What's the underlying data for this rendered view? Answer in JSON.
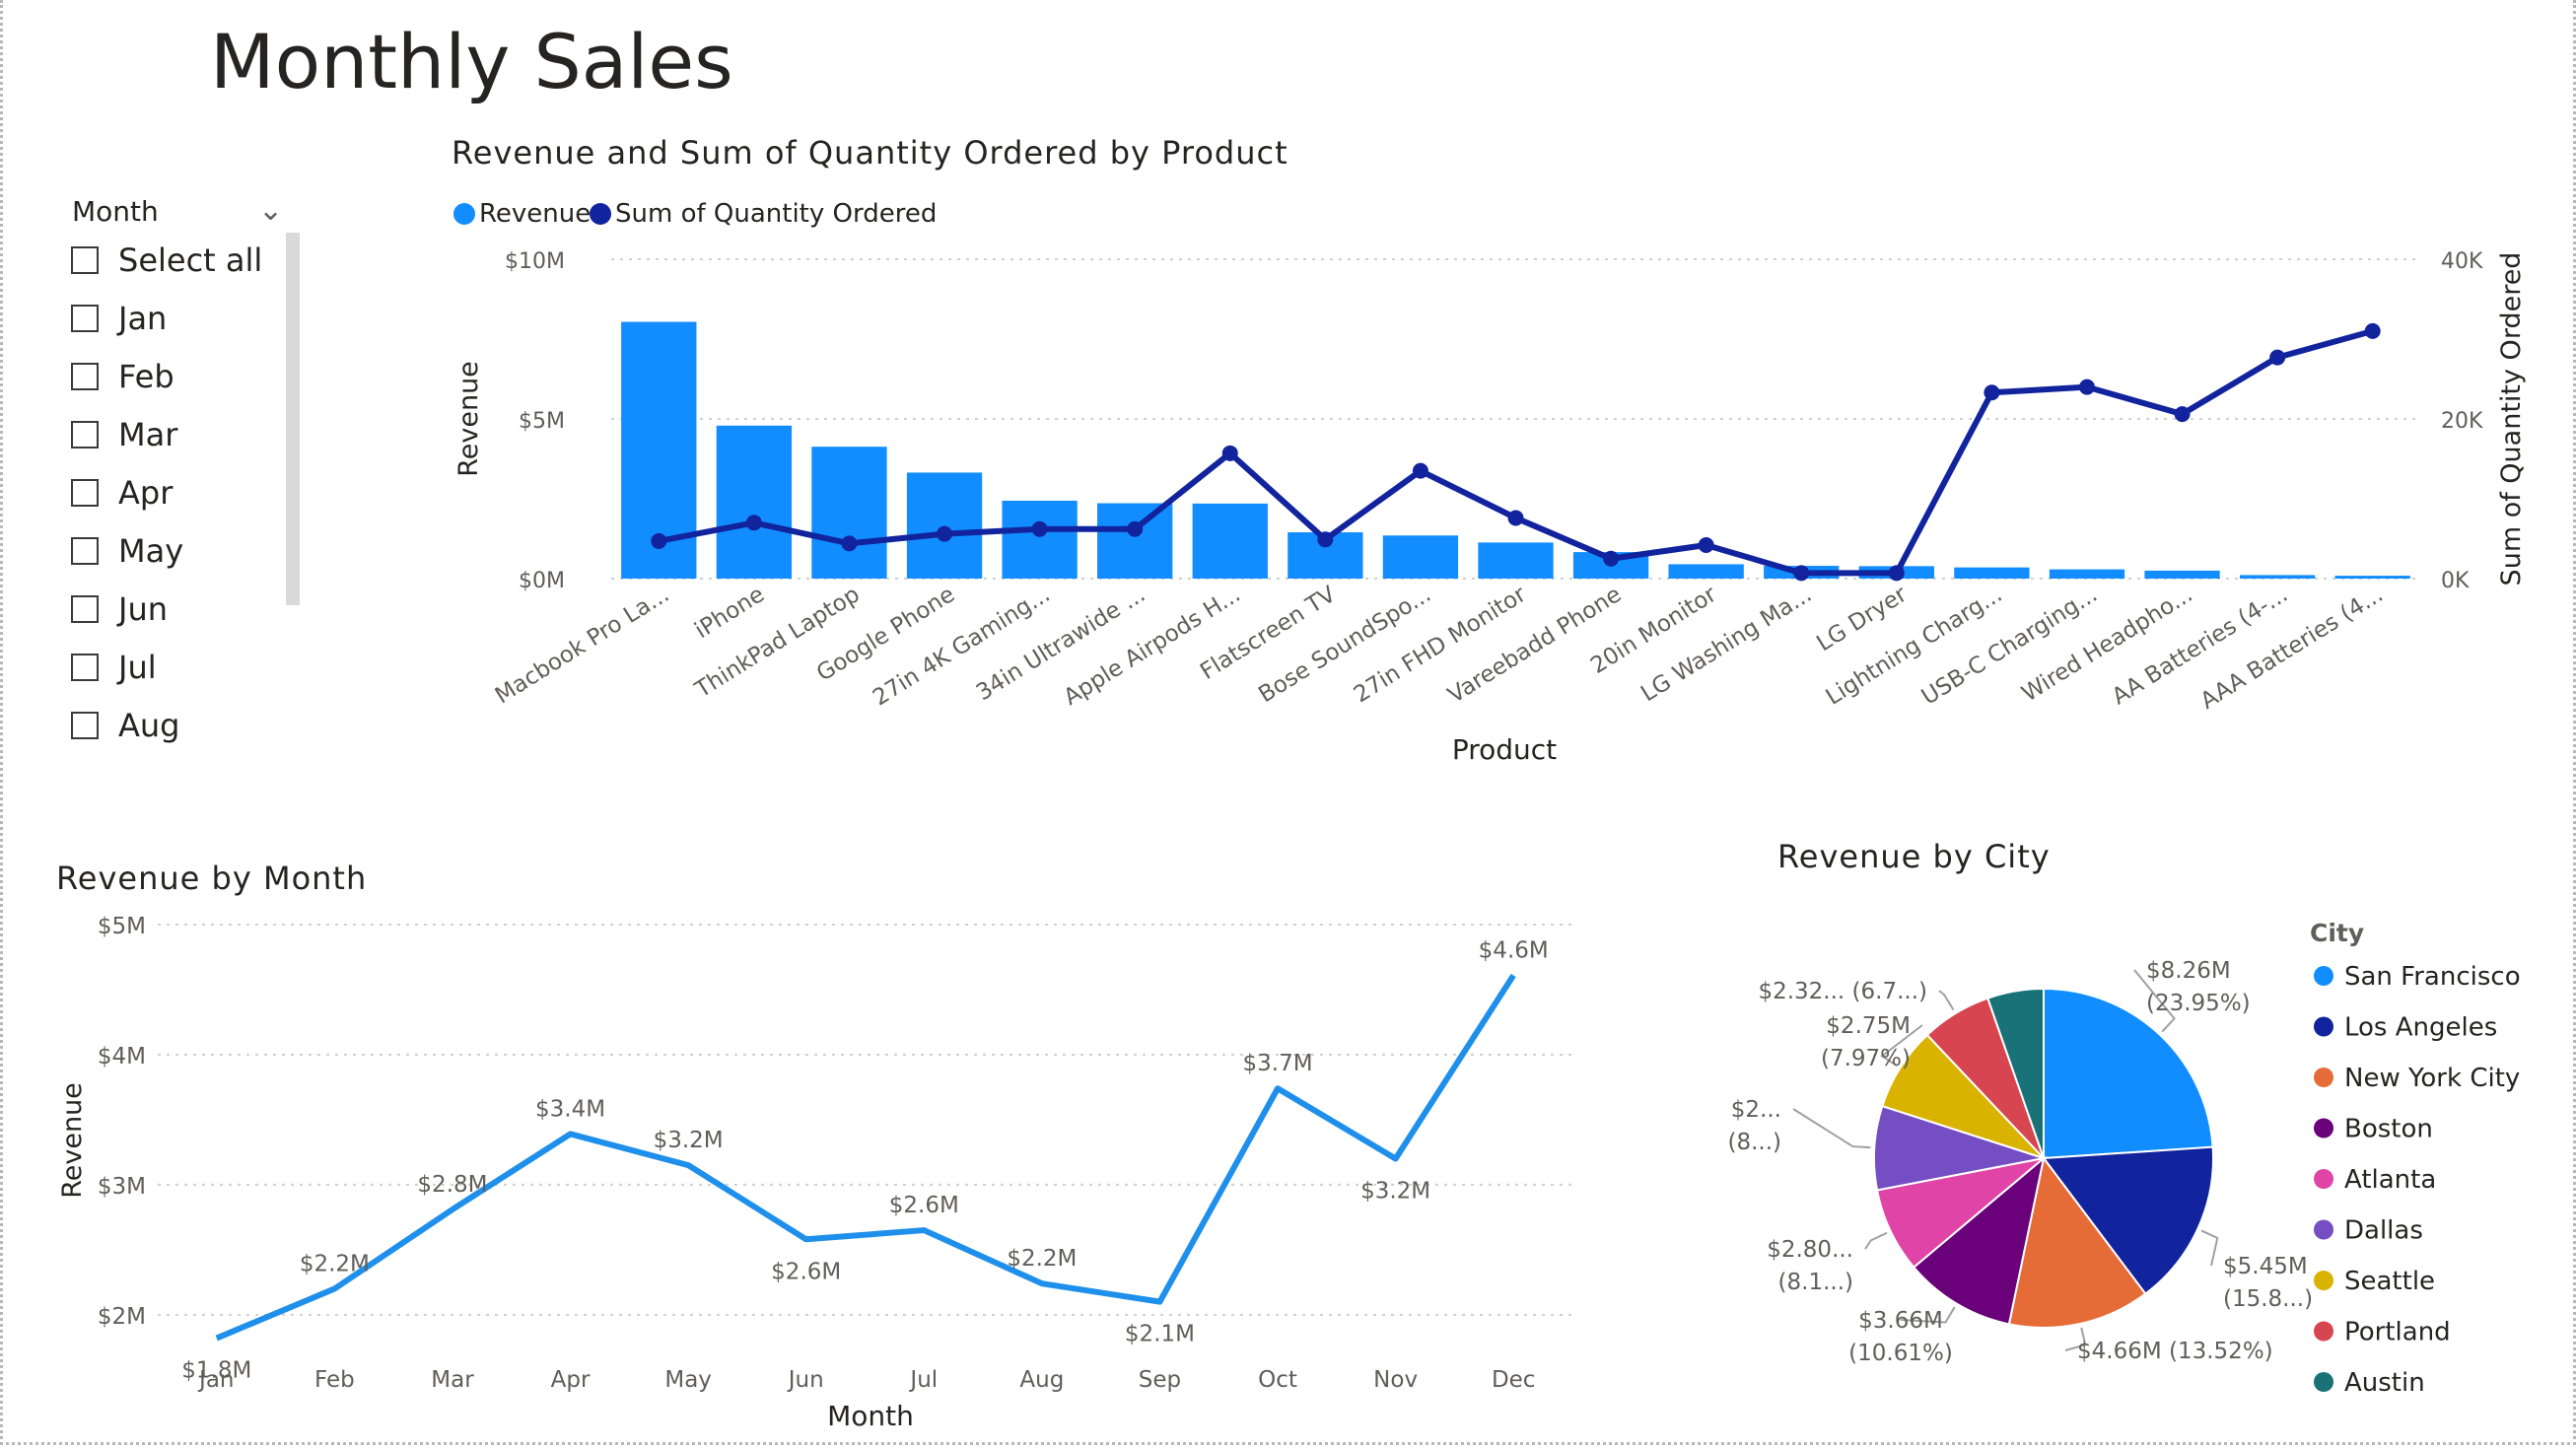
{
  "page": {
    "title": "Monthly Sales"
  },
  "slicer": {
    "header": "Month",
    "items": [
      "Select all",
      "Jan",
      "Feb",
      "Mar",
      "Apr",
      "May",
      "Jun",
      "Jul",
      "Aug"
    ]
  },
  "combo_title": "Revenue and Sum of Quantity Ordered by Product",
  "month_title": "Revenue by Month",
  "city_title": "Revenue by City",
  "colors": {
    "revenue": "#118DFF",
    "quantity": "#12239E",
    "line": "#1E8FEB",
    "pie": [
      "#118DFF",
      "#12239E",
      "#E66C37",
      "#6B007B",
      "#E044A7",
      "#744EC2",
      "#D9B300",
      "#D64550",
      "#197278"
    ]
  },
  "chart_data": [
    {
      "type": "bar",
      "subtype": "combo bar + line, dual axis",
      "title": "Revenue and Sum of Quantity Ordered by Product",
      "xlabel": "Product",
      "ylabel": "Revenue",
      "y2label": "Sum of Quantity Ordered",
      "ylim": [
        0,
        10000000
      ],
      "y2lim": [
        0,
        40000
      ],
      "yticks": [
        "$0M",
        "$5M",
        "$10M"
      ],
      "y2ticks": [
        "0K",
        "20K",
        "40K"
      ],
      "legend": "top-left",
      "grid": true,
      "categories": [
        "Macbook Pro La...",
        "iPhone",
        "ThinkPad Laptop",
        "Google Phone",
        "27in 4K Gaming...",
        "34in Ultrawide ...",
        "Apple Airpods H...",
        "Flatscreen TV",
        "Bose SoundSpo...",
        "27in FHD Monitor",
        "Vareebadd Phone",
        "20in Monitor",
        "LG Washing Ma...",
        "LG Dryer",
        "Lightning Charg...",
        "USB-C Charging...",
        "Wired Headpho...",
        "AA Batteries (4-...",
        "AAA Batteries (4..."
      ],
      "series": [
        {
          "name": "Revenue",
          "axis": "left",
          "type": "bar",
          "values": [
            8040000,
            4790000,
            4130000,
            3320000,
            2440000,
            2360000,
            2350000,
            1450000,
            1350000,
            1130000,
            830000,
            450000,
            400000,
            390000,
            350000,
            290000,
            250000,
            110000,
            90000
          ]
        },
        {
          "name": "Sum of Quantity Ordered",
          "axis": "right",
          "type": "line",
          "values": [
            4700,
            7000,
            4400,
            5600,
            6200,
            6200,
            15700,
            4900,
            13500,
            7600,
            2500,
            4200,
            700,
            700,
            23300,
            24000,
            20600,
            27700,
            31000
          ]
        }
      ]
    },
    {
      "type": "line",
      "title": "Revenue by Month",
      "xlabel": "Month",
      "ylabel": "Revenue",
      "ylim": [
        1650000,
        5000000
      ],
      "yticks": [
        {
          "value": 2000000,
          "label": "$2M"
        },
        {
          "value": 3000000,
          "label": "$3M"
        },
        {
          "value": 4000000,
          "label": "$4M"
        },
        {
          "value": 5000000,
          "label": "$5M"
        }
      ],
      "grid": true,
      "categories": [
        "Jan",
        "Feb",
        "Mar",
        "Apr",
        "May",
        "Jun",
        "Jul",
        "Aug",
        "Sep",
        "Oct",
        "Nov",
        "Dec"
      ],
      "values": [
        1820000,
        2200000,
        2810000,
        3390000,
        3150000,
        2580000,
        2650000,
        2240000,
        2100000,
        3740000,
        3200000,
        4610000
      ],
      "data_labels": [
        "$1.8M",
        "$2.2M",
        "$2.8M",
        "$3.4M",
        "$3.2M",
        "$2.6M",
        "$2.6M",
        "$2.2M",
        "$2.1M",
        "$3.7M",
        "$3.2M",
        "$4.6M"
      ],
      "label_position": [
        "below",
        "above",
        "above",
        "above",
        "above",
        "below",
        "above",
        "above",
        "below",
        "above",
        "below",
        "above"
      ]
    },
    {
      "type": "pie",
      "title": "Revenue by City",
      "legend_title": "City",
      "legend": "right",
      "labels": [
        "San Francisco",
        "Los Angeles",
        "New York City",
        "Boston",
        "Atlanta",
        "Dallas",
        "Seattle",
        "Portland",
        "Austin"
      ],
      "values": [
        23.95,
        15.8,
        13.52,
        10.61,
        8.1,
        8.0,
        7.97,
        6.7,
        5.35
      ],
      "data_labels": [
        [
          "$8.26M",
          "(23.95%)"
        ],
        [
          "$5.45M",
          "(15.8...)"
        ],
        [
          "$4.66M (13.52%)"
        ],
        [
          "$3.66M",
          "(10.61%)"
        ],
        [
          "$2.80...",
          "(8.1...)"
        ],
        [
          "$2...",
          "(8...)"
        ],
        [
          "$2.75M",
          "(7.97%)"
        ],
        [
          "$2.32... (6.7...)"
        ],
        []
      ]
    }
  ]
}
